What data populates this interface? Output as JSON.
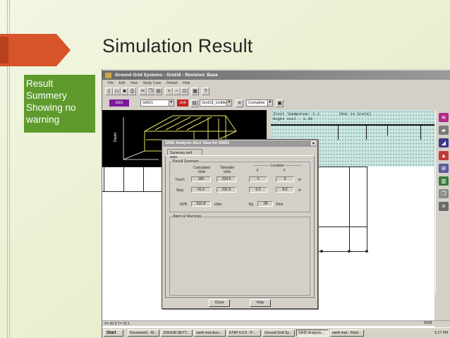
{
  "slide": {
    "title": "Simulation Result",
    "callout": "Result\nSummery\nShowing no\nwarning",
    "accent_orange": "#d8542b",
    "accent_green": "#5f9a2d"
  },
  "app": {
    "window_title": "Ground Grid Systems - Grid18 - Revision: Base",
    "menu": [
      "File",
      "Edit",
      "View",
      "Study Case",
      "Default",
      "Help"
    ],
    "toolbar_combo_grid": "GRD1",
    "toolbar_combo_case": "Grid18_Untitled",
    "toolbar_combo_status": "Complete",
    "toolbar_badge": "SSG",
    "toolbar_badge_red": "Unit",
    "grid_panel": {
      "line1": "Ztest l&ampstep: 1.1",
      "line1_right": "(Not to Scale)",
      "line2": "Right coil - 1.40"
    }
  },
  "dialog": {
    "title": "GRID Analysis Alert View for GRD1",
    "tab": "Summary and Alert",
    "result_summary": {
      "group_label": "Result Summary",
      "col_calculated": "Calculated\nVolts",
      "col_tolerable": "Tolerable\nVolts",
      "col_location": "-------------- Location --------------",
      "col_x": "X",
      "col_y": "Y",
      "rows": [
        {
          "label": "Touch",
          "calculated": "183",
          "tolerable": "224.5",
          "x": "0",
          "y": "9",
          "unit": "m"
        },
        {
          "label": "Step",
          "calculated": "41.6",
          "tolerable": "231.9",
          "x": "0.0",
          "y": "8.0",
          "unit": "m"
        }
      ],
      "gpr_label": "GPR",
      "gpr_value": "510.8",
      "gpr_unit": "Volts",
      "rg_label": "Rg",
      "rg_value": ".09",
      "rg_unit": "Ohm"
    },
    "alarms_label": "Alarm & Warnings",
    "close_button": "Close",
    "help_button": "Help"
  },
  "statusbar": {
    "left": "X= 60.9  Y= 32.1",
    "right": "NUM"
  },
  "taskbar": {
    "start": "Start",
    "tasks": [
      "Document1 - M...",
      "JOKAJR DEYT...",
      "earth mat desi...",
      "ETAP 6.0.0 - P...",
      "Ground Grid Sy...",
      "GRID Analysis...",
      "earth mat - Paint"
    ],
    "clock": "5:17 PM"
  }
}
